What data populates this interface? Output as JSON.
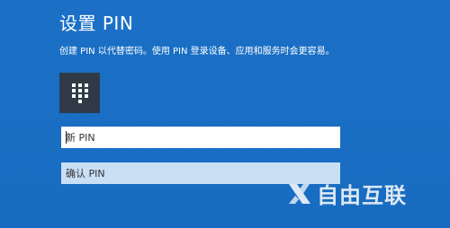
{
  "dialog": {
    "title": "设置 PIN",
    "subtitle": "创建 PIN 以代替密码。使用 PIN 登录设备、应用和服务时会更容易。",
    "pin_tile_icon": "keypad-icon"
  },
  "fields": {
    "new_pin_placeholder": "新 PIN",
    "confirm_pin_placeholder": "确认 PIN"
  },
  "watermark": {
    "text": "自由互联",
    "icon": "x-logo-icon"
  },
  "colors": {
    "background": "#1a6fc4",
    "tile": "#2f3a46",
    "confirm_field": "#c9dff4"
  }
}
